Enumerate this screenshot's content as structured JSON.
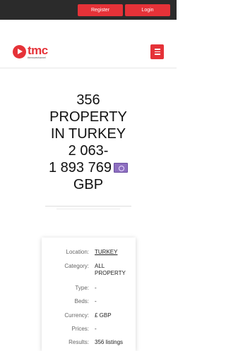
{
  "topbar": {
    "register_label": "Register",
    "login_label": "Login"
  },
  "header": {
    "logo_word": "tmc",
    "logo_sub": "themovechannel"
  },
  "title": {
    "line1": "356",
    "line2": "PROPERTY",
    "line3": "IN TURKEY",
    "line4": "2 063-",
    "line5": "1 893 769",
    "line6": "GBP"
  },
  "details": {
    "location_label": "Location:",
    "location_value": "TURKEY",
    "category_label": "Category:",
    "category_value": "ALL PROPERTY",
    "type_label": "Type:",
    "type_value": "-",
    "beds_label": "Beds:",
    "beds_value": "-",
    "currency_label": "Currency:",
    "currency_value": "£ GBP",
    "prices_label": "Prices:",
    "prices_value": "-",
    "results_label": "Results:",
    "results_value": "356 listings"
  },
  "colors": {
    "brand_red": "#e53238",
    "topbar_bg": "#2b2b2b"
  }
}
